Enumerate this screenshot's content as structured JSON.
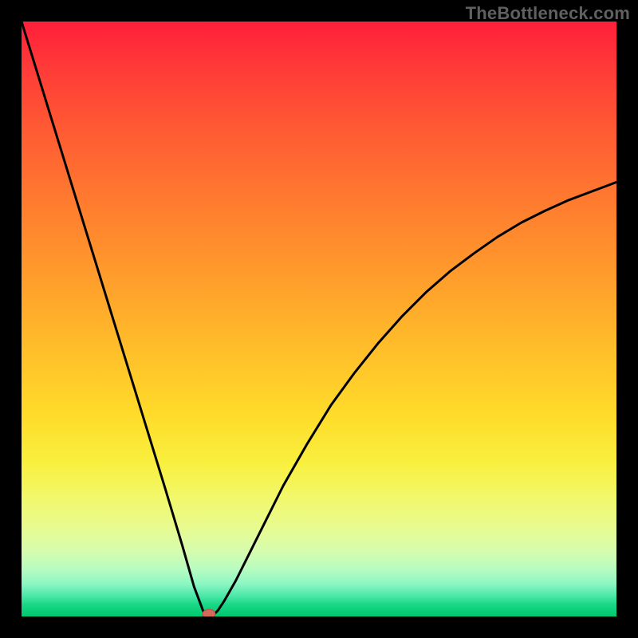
{
  "watermark": "TheBottleneck.com",
  "chart_data": {
    "type": "line",
    "title": "",
    "xlabel": "",
    "ylabel": "",
    "xlim": [
      0,
      100
    ],
    "ylim": [
      0,
      100
    ],
    "grid": false,
    "legend": false,
    "series": [
      {
        "name": "bottleneck-curve",
        "x": [
          0,
          4,
          8,
          12,
          16,
          20,
          24,
          27,
          29,
          30.5,
          31,
          31.5,
          32,
          33,
          34,
          36,
          38,
          40,
          44,
          48,
          52,
          56,
          60,
          64,
          68,
          72,
          76,
          80,
          84,
          88,
          92,
          96,
          100
        ],
        "y": [
          100,
          87,
          74,
          61,
          48,
          35,
          22,
          12,
          5,
          1,
          0,
          0,
          0,
          1,
          2.5,
          6,
          10,
          14,
          22,
          29,
          35.5,
          41,
          46,
          50.5,
          54.5,
          58,
          61,
          63.8,
          66.2,
          68.2,
          70,
          71.5,
          73
        ]
      }
    ],
    "marker": {
      "x": 31.5,
      "y": 0,
      "color": "#d46a5a"
    },
    "gradient_stops": [
      {
        "pos": 0.0,
        "color": "#ff1f3a"
      },
      {
        "pos": 0.3,
        "color": "#ff7a2f"
      },
      {
        "pos": 0.66,
        "color": "#ffdb2a"
      },
      {
        "pos": 0.85,
        "color": "#e8fb8f"
      },
      {
        "pos": 1.0,
        "color": "#00c96e"
      }
    ]
  }
}
